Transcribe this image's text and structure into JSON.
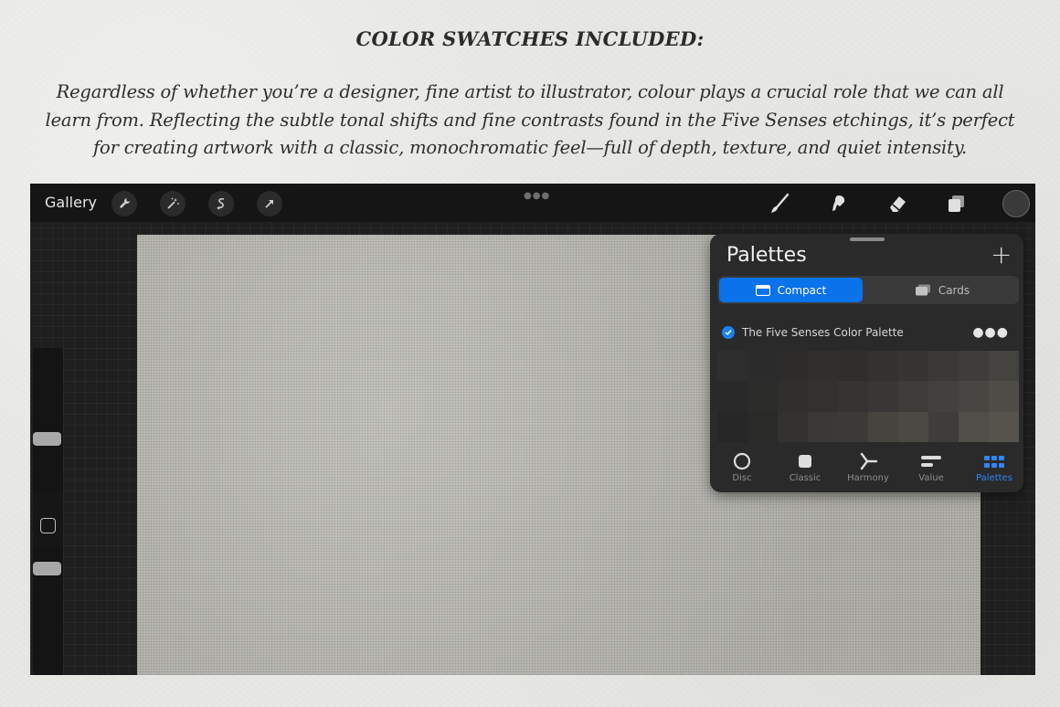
{
  "heading": "COLOR SWATCHES INCLUDED:",
  "intro": "Regardless of whether you’re a designer, fine artist to illustrator, colour plays a crucial role that we can all learn from. Reflecting the subtle tonal shifts and fine contrasts found in the Five Senses etchings, it’s perfect for creating artwork with a classic, monochromatic feel—full of depth, texture, and quiet intensity.",
  "topbar": {
    "gallery_label": "Gallery",
    "left_tools": [
      "wrench-icon",
      "magic-wand-icon",
      "selection-icon",
      "transform-arrow-icon"
    ],
    "right_tools": [
      "brush-icon",
      "smudge-icon",
      "eraser-icon",
      "layers-icon"
    ],
    "current_color": "#3a3a3a"
  },
  "palettes_panel": {
    "title": "Palettes",
    "add_icon": "plus-icon",
    "view_modes": {
      "compact_label": "Compact",
      "cards_label": "Cards",
      "selected": "Compact"
    },
    "palette": {
      "name": "The Five Senses Color Palette",
      "checked": true,
      "more_icon": "ellipsis-icon",
      "swatches": [
        [
          "#2e2e2e",
          "#2b2b2b",
          "#2d2c2b",
          "#302f2e",
          "#2f2e2d",
          "#333231",
          "#363534",
          "#3a3937",
          "#3e3d3b",
          "#44433f"
        ],
        [
          "#292929",
          "#2c2c2b",
          "#302f2e",
          "#32312f",
          "#353432",
          "#383735",
          "#3d3c39",
          "#42413e",
          "#474642",
          "#4d4c47"
        ],
        [
          "#262626",
          "#2a2a29",
          "#33322f",
          "#3a3936",
          "#3b3a37",
          "#45443f",
          "#4a4944",
          "#3e3d39",
          "#4f4e48",
          "#55534c"
        ]
      ]
    },
    "color_modes": [
      {
        "label": "Disc",
        "icon": "disc-icon",
        "active": false
      },
      {
        "label": "Classic",
        "icon": "classic-square-icon",
        "active": false
      },
      {
        "label": "Harmony",
        "icon": "harmony-icon",
        "active": false
      },
      {
        "label": "Value",
        "icon": "value-bars-icon",
        "active": false
      },
      {
        "label": "Palettes",
        "icon": "palettes-grid-icon",
        "active": true
      }
    ]
  },
  "accent_color": "#0a72ea"
}
